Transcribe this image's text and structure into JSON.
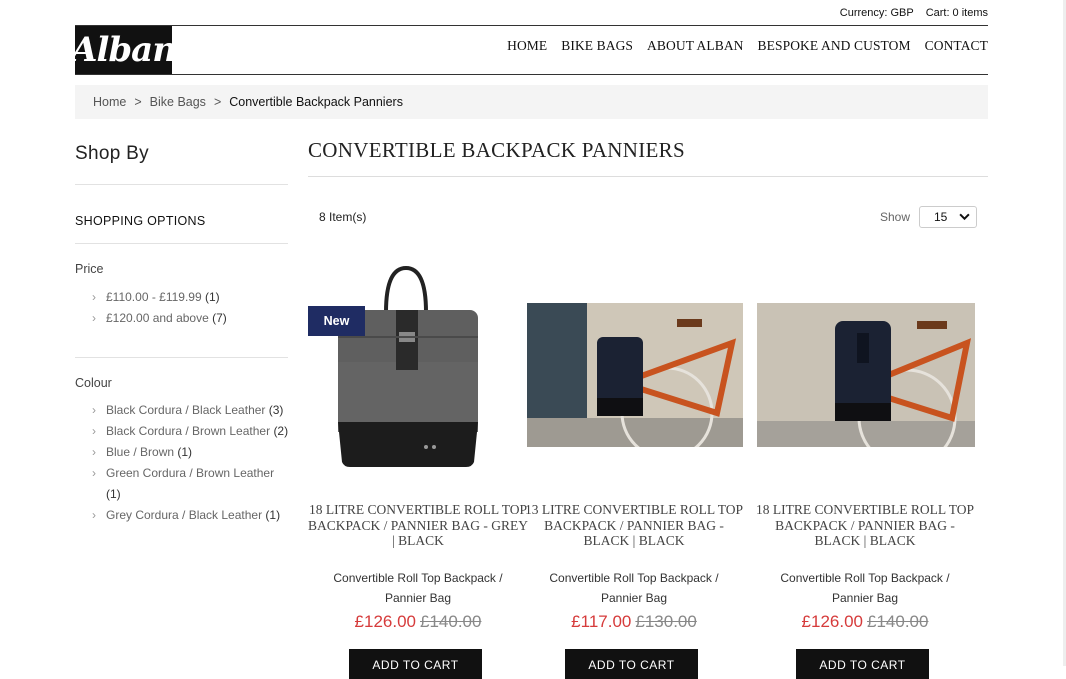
{
  "topbar": {
    "currency_label": "Currency:",
    "currency_value": "GBP",
    "cart_label": "Cart:",
    "cart_value": "0 items"
  },
  "logo": {
    "text": "Alban"
  },
  "nav": {
    "items": [
      "HOME",
      "BIKE BAGS",
      "ABOUT ALBAN",
      "BESPOKE AND CUSTOM",
      "CONTACT"
    ]
  },
  "breadcrumb": {
    "home": "Home",
    "sep1": ">",
    "bike_bags": "Bike Bags",
    "sep2": ">",
    "current": "Convertible Backpack Panniers"
  },
  "sidebar": {
    "title": "Shop By",
    "shopping_options": "SHOPPING OPTIONS",
    "price": {
      "title": "Price",
      "items": [
        {
          "label": "£110.00 - £119.99",
          "count": "(1)"
        },
        {
          "label": "£120.00 and above",
          "count": "(7)"
        }
      ]
    },
    "colour": {
      "title": "Colour",
      "items": [
        {
          "label": "Black Cordura / Black Leather",
          "count": "(3)"
        },
        {
          "label": "Black Cordura / Brown Leather",
          "count": "(2)"
        },
        {
          "label": "Blue / Brown",
          "count": "(1)"
        },
        {
          "label": "Green Cordura / Brown Leather",
          "count": "(1)"
        },
        {
          "label": "Grey Cordura / Black Leather",
          "count": "(1)"
        }
      ]
    }
  },
  "main": {
    "title": "CONVERTIBLE BACKPACK PANNIERS",
    "items_count": "8 Item(s)",
    "show_label": "Show",
    "show_value": "15"
  },
  "products": [
    {
      "badge": "New",
      "name": "18 LITRE CONVERTIBLE ROLL TOP BACKPACK / PANNIER BAG - GREY | BLACK",
      "subtitle": "Convertible Roll Top Backpack / Pannier Bag",
      "price": "£126.00",
      "old_price": "£140.00",
      "cart_label": "ADD TO CART"
    },
    {
      "badge": "",
      "name": "13 LITRE CONVERTIBLE ROLL TOP BACKPACK / PANNIER BAG - BLACK | BLACK",
      "subtitle": "Convertible Roll Top Backpack / Pannier Bag",
      "price": "£117.00",
      "old_price": "£130.00",
      "cart_label": "ADD TO CART"
    },
    {
      "badge": "",
      "name": "18 LITRE CONVERTIBLE ROLL TOP BACKPACK / PANNIER BAG - BLACK | BLACK",
      "subtitle": "Convertible Roll Top Backpack / Pannier Bag",
      "price": "£126.00",
      "old_price": "£140.00",
      "cart_label": "ADD TO CART"
    }
  ],
  "colors": {
    "sale_price": "#d63b3b",
    "badge_bg": "#1f2c63",
    "cart_button": "#111111"
  }
}
